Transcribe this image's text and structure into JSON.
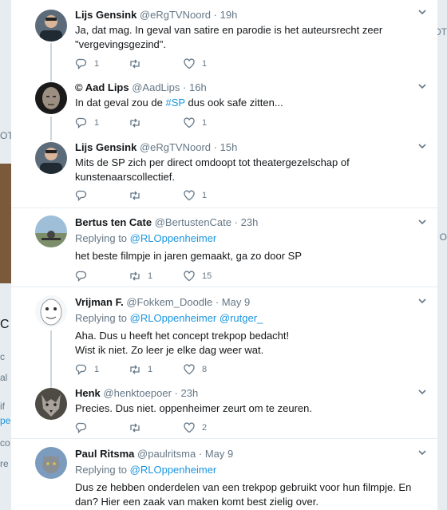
{
  "tweets": [
    {
      "name": "Lijs Gensink",
      "handle": "@eRgTVNoord",
      "time": "19h",
      "reply_to": "",
      "text": "Ja, dat mag. In geval van satire en parodie is het auteursrecht zeer \"vergevingsgezind\".",
      "replies": "1",
      "retweets": "",
      "likes": "1"
    },
    {
      "name": "© Aad Lips",
      "handle": "@AadLips",
      "time": "16h",
      "reply_to": "",
      "text_before": "In dat geval zou de ",
      "hashtag": "#SP",
      "text_after": " dus ook safe zitten...",
      "replies": "1",
      "retweets": "",
      "likes": "1"
    },
    {
      "name": "Lijs Gensink",
      "handle": "@eRgTVNoord",
      "time": "15h",
      "reply_to": "",
      "text": "Mits de SP zich per direct omdoopt tot theatergezelschap of kunstenaarscollectief.",
      "replies": "",
      "retweets": "",
      "likes": "1"
    },
    {
      "name": "Bertus ten Cate",
      "handle": "@BertustenCate",
      "time": "23h",
      "replying_label": "Replying to",
      "reply_to": "@RLOppenheimer",
      "text": "het beste filmpje in jaren gemaakt, ga zo door SP",
      "replies": "",
      "retweets": "1",
      "likes": "15"
    },
    {
      "name": "Vrijman F.",
      "handle": "@Fokkem_Doodle",
      "time": "May 9",
      "replying_label": "Replying to",
      "reply_to": "@RLOppenheimer @rutger_",
      "text": "Aha. Dus u heeft het concept trekpop bedacht!\nWist ik niet. Zo leer je elke dag weer wat.",
      "replies": "1",
      "retweets": "1",
      "likes": "8"
    },
    {
      "name": "Henk",
      "handle": "@henktoepoer",
      "time": "23h",
      "reply_to": "",
      "text": "Precies. Dus niet. oppenheimer zeurt om te zeuren.",
      "replies": "",
      "retweets": "",
      "likes": "2"
    },
    {
      "name": "Paul Ritsma",
      "handle": "@paulritsma",
      "time": "May 9",
      "replying_label": "Replying to",
      "reply_to": "@RLOppenheimer",
      "text": "Dus ze hebben onderdelen van een trekpop gebruikt voor hun filmpje. En dan? Hier een zaak van maken komt best zielig over.",
      "replies": "",
      "retweets": "",
      "likes": ""
    }
  ],
  "background_fragments": [
    "OT",
    "OT",
    "C",
    "c",
    "al",
    "if",
    "pe",
    "co",
    "re",
    "O"
  ],
  "colors": {
    "link": "#1b95e0",
    "meta": "#657786",
    "thread_line": "#ccd6dd",
    "border": "#e6ecf0"
  },
  "icons": [
    "reply-icon",
    "retweet-icon",
    "like-icon",
    "caret-down-icon"
  ]
}
